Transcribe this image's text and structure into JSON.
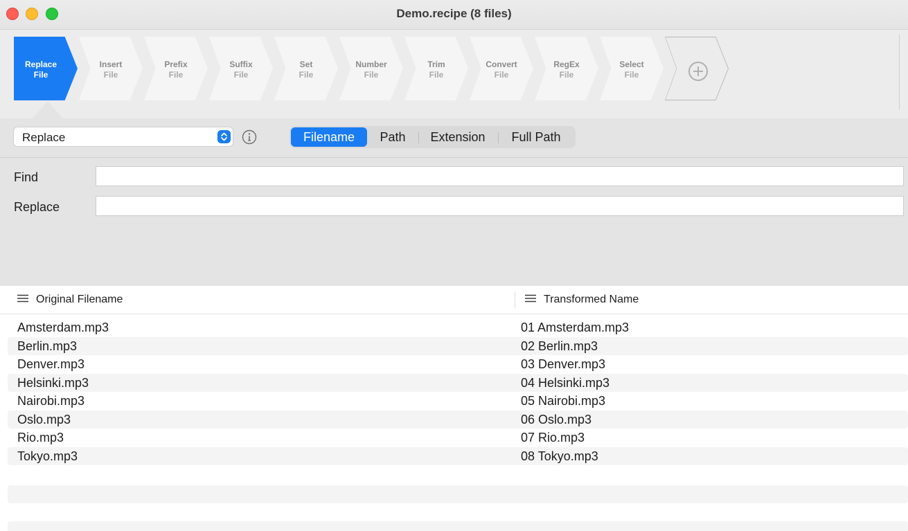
{
  "window": {
    "title": "Demo.recipe (8 files)"
  },
  "steps": [
    {
      "title": "Replace",
      "sub": "File",
      "active": true
    },
    {
      "title": "Insert",
      "sub": "File"
    },
    {
      "title": "Prefix",
      "sub": "File"
    },
    {
      "title": "Suffix",
      "sub": "File"
    },
    {
      "title": "Set",
      "sub": "File"
    },
    {
      "title": "Number",
      "sub": "File"
    },
    {
      "title": "Trim",
      "sub": "File"
    },
    {
      "title": "Convert",
      "sub": "File"
    },
    {
      "title": "RegEx",
      "sub": "File"
    },
    {
      "title": "Select",
      "sub": "File"
    }
  ],
  "add_step_icon": "plus-circle-icon",
  "options": {
    "mode_select": {
      "value": "Replace"
    },
    "info_icon": "info-circle-icon",
    "scope_tabs": [
      {
        "label": "Filename",
        "active": true
      },
      {
        "label": "Path"
      },
      {
        "label": "Extension"
      },
      {
        "label": "Full Path"
      }
    ],
    "find": {
      "label": "Find",
      "value": ""
    },
    "replace": {
      "label": "Replace",
      "value": ""
    }
  },
  "colors": {
    "accent": "#1a7cf2"
  },
  "file_list": {
    "columns": [
      {
        "label": "Original Filename",
        "icon": "hamburger-menu-icon"
      },
      {
        "label": "Transformed Name",
        "icon": "hamburger-menu-icon"
      }
    ],
    "rows": [
      {
        "original": "Amsterdam.mp3",
        "transformed": "01 Amsterdam.mp3"
      },
      {
        "original": "Berlin.mp3",
        "transformed": "02 Berlin.mp3"
      },
      {
        "original": "Denver.mp3",
        "transformed": "03 Denver.mp3"
      },
      {
        "original": "Helsinki.mp3",
        "transformed": "04 Helsinki.mp3"
      },
      {
        "original": "Nairobi.mp3",
        "transformed": "05 Nairobi.mp3"
      },
      {
        "original": "Oslo.mp3",
        "transformed": "06 Oslo.mp3"
      },
      {
        "original": "Rio.mp3",
        "transformed": "07 Rio.mp3"
      },
      {
        "original": "Tokyo.mp3",
        "transformed": "08 Tokyo.mp3"
      }
    ]
  }
}
